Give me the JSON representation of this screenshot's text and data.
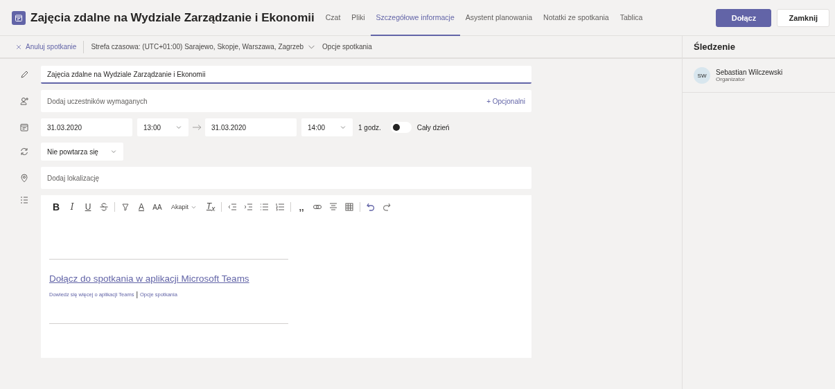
{
  "header": {
    "title": "Zajęcia zdalne na Wydziale Zarządzanie i Ekonomii",
    "tabs": [
      {
        "label": "Czat",
        "selected": false
      },
      {
        "label": "Pliki",
        "selected": false
      },
      {
        "label": "Szczegółowe informacje",
        "selected": true
      },
      {
        "label": "Asystent planowania",
        "selected": false
      },
      {
        "label": "Notatki ze spotkania",
        "selected": false
      },
      {
        "label": "Tablica",
        "selected": false
      }
    ],
    "buttons": [
      {
        "label": "Dołącz",
        "kind": "primary"
      },
      {
        "label": "Zamknij",
        "kind": "secondary"
      }
    ]
  },
  "toolbar": {
    "cancel": "Anuluj spotkanie",
    "timezone": "Strefa czasowa: (UTC+01:00) Sarajewo, Skopje, Warszawa, Zagrzeb",
    "options": "Opcje spotkania"
  },
  "form": {
    "title_value": "Zajęcia zdalne na Wydziale Zarządzanie i Ekonomii",
    "attendees_placeholder": "Dodaj uczestników wymaganych",
    "optional": "+ Opcjonalni",
    "start_date": "31.03.2020",
    "start_time": "13:00",
    "end_date": "31.03.2020",
    "end_time": "14:00",
    "duration": "1 godz.",
    "all_day": {
      "label": "Cały dzień",
      "on": false
    },
    "repeat": "Nie powtarza się",
    "location_placeholder": "Dodaj lokalizację"
  },
  "editor": {
    "tools": [
      {
        "kind": "bold",
        "label": "B"
      },
      {
        "kind": "italic",
        "label": "I"
      },
      {
        "kind": "underline",
        "label": "U"
      },
      {
        "kind": "strike"
      },
      {
        "kind": "sep"
      },
      {
        "kind": "highlight"
      },
      {
        "kind": "color",
        "label": "A"
      },
      {
        "kind": "size",
        "label": "AA"
      },
      {
        "kind": "dropdown",
        "label": "Akapit"
      },
      {
        "kind": "clear",
        "label": "T$_{x}$"
      },
      {
        "kind": "sep"
      },
      {
        "kind": "outdent"
      },
      {
        "kind": "indent"
      },
      {
        "kind": "bullets"
      },
      {
        "kind": "numbers"
      },
      {
        "kind": "sep"
      },
      {
        "kind": "quote",
        "label": ",,"
      },
      {
        "kind": "link"
      },
      {
        "kind": "align"
      },
      {
        "kind": "table"
      },
      {
        "kind": "sep"
      },
      {
        "kind": "undo"
      },
      {
        "kind": "redo"
      }
    ],
    "join_link": "Dołącz do spotkania w aplikacji Microsoft Teams",
    "learn_link": "Dowiedz się więcej o aplikacji Teams",
    "separator": "|",
    "options_link": "Opcje spotkania"
  },
  "side": {
    "title": "Śledzenie",
    "people": [
      {
        "initials": "SW",
        "name": "Sebastian Wilczewski",
        "role": "Organizator"
      }
    ]
  }
}
